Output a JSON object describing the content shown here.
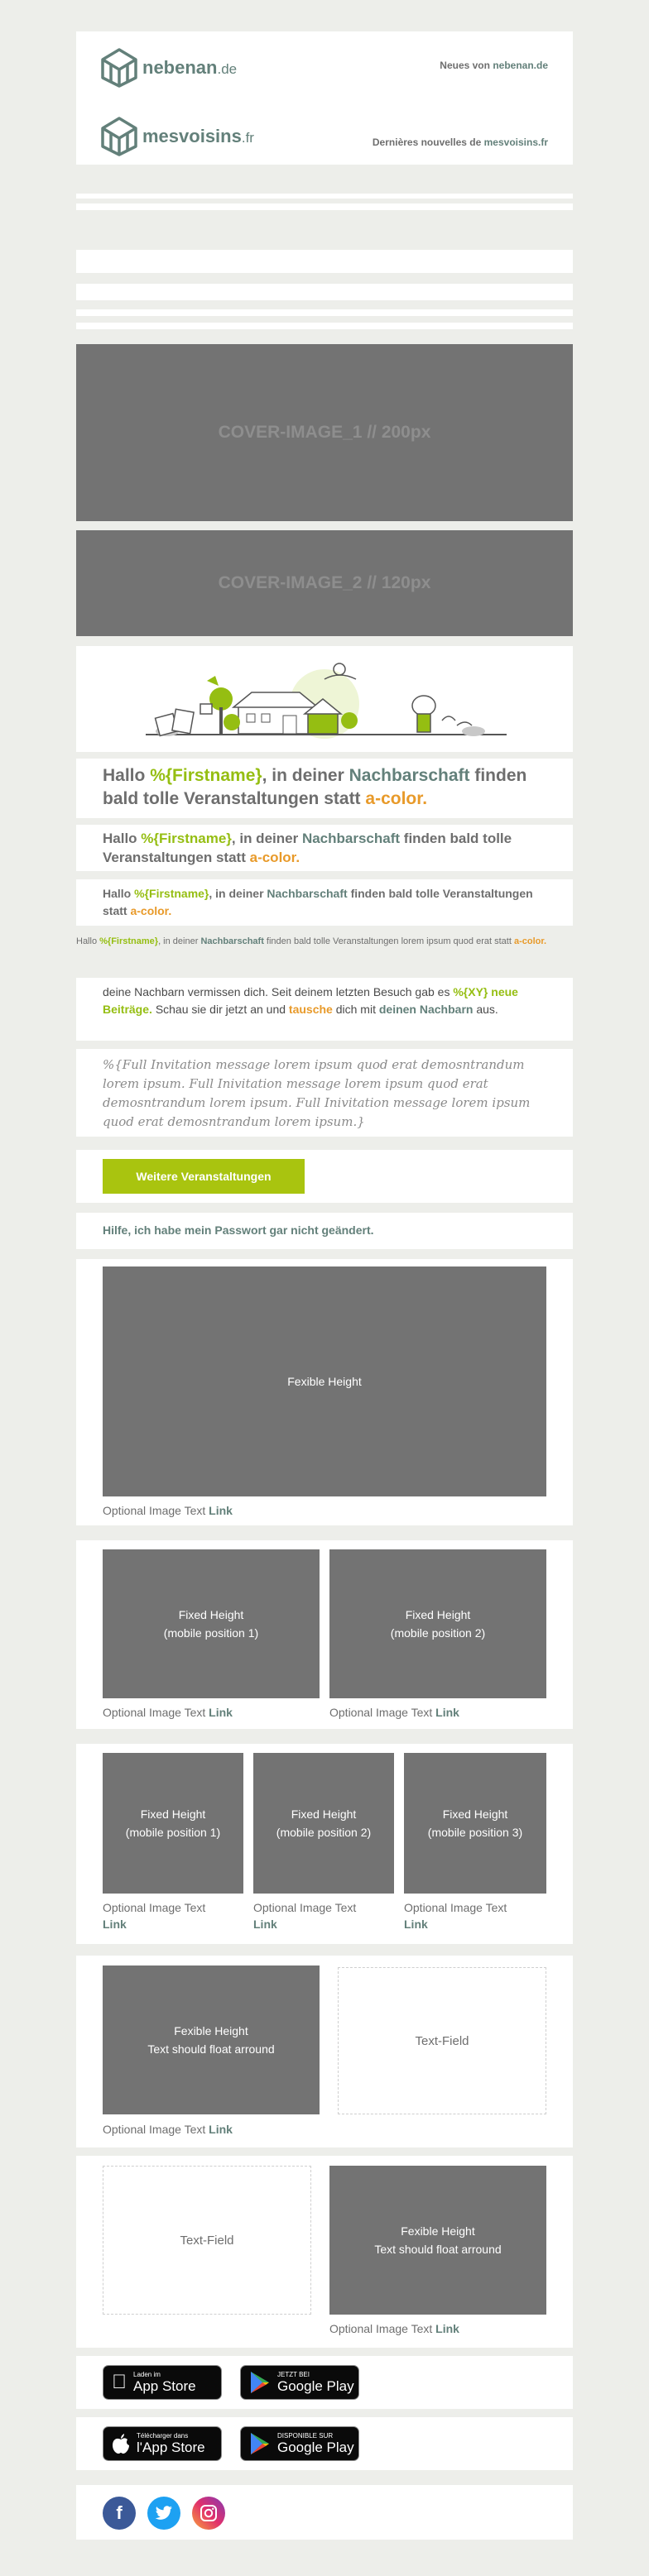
{
  "header_de": {
    "brand": "nebenan",
    "tld": ".de",
    "note_prefix": "Neues von",
    "note_highlight": "nebenan.de"
  },
  "header_fr": {
    "brand": "mesvoisins",
    "tld": ".fr",
    "note_prefix": "Dernières nouvelles de",
    "note_highlight": "mesvoisins.fr"
  },
  "covers": {
    "cover1": "COVER-IMAGE_1 // 200px",
    "cover2": "COVER-IMAGE_2 // 120px"
  },
  "greeting": {
    "hallo": "Hallo",
    "firstname": "%{Firstname}",
    "mid": ", in deiner",
    "nachbarschaft": "Nachbarschaft",
    "tail": "finden bald tolle Veranstaltungen statt",
    "color": "a-color.",
    "small_tail": "finden bald tolle Veranstaltungen lorem ipsum quod erat statt"
  },
  "body_text": {
    "part1": "deine Nachbarn vermissen dich. Seit deinem letzten Besuch gab es",
    "xy": "%{XY} neue Beiträge.",
    "part2": "Schau sie dir jetzt an und",
    "tausche": "tausche",
    "part3": "dich mit",
    "nachbarn": "deinen Nachbarn",
    "part4": "aus."
  },
  "invitation": "%{Full Invitation message lorem ipsum quod erat demosntrandum lorem ipsum. Full Inivitation message lorem ipsum quod erat demosntrandum lorem ipsum. Full Inivitation message lorem ipsum quod erat demosntrandum lorem ipsum.}",
  "cta_button": "Weitere Veranstaltungen",
  "help_link": "Hilfe, ich habe mein Passwort gar nicht geändert.",
  "images": {
    "flexible": "Fexible Height",
    "caption": "Optional Image Text",
    "caption_link": "Link",
    "fixed": "Fixed Height",
    "pos1": "(mobile position 1)",
    "pos2": "(mobile position 2)",
    "pos3": "(mobile position 3)",
    "float_title": "Fexible Height",
    "float_sub": "Text should float arround",
    "text_field": "Text-Field"
  },
  "app_badges": {
    "appstore_de_small": "Laden im",
    "appstore_de_big": "App Store",
    "googleplay_de_small": "JETZT BEI",
    "googleplay_de_big": "Google Play",
    "appstore_fr_small": "Télécharger dans",
    "appstore_fr_big": "l'App Store",
    "googleplay_fr_small": "DISPONIBLE SUR",
    "googleplay_fr_big": "Google Play"
  },
  "social": {
    "facebook": "f"
  },
  "colors": {
    "brand": "#63807a",
    "green": "#95be12",
    "orange": "#e89a2a",
    "bg": "#edeeea",
    "placeholder": "#737373"
  }
}
